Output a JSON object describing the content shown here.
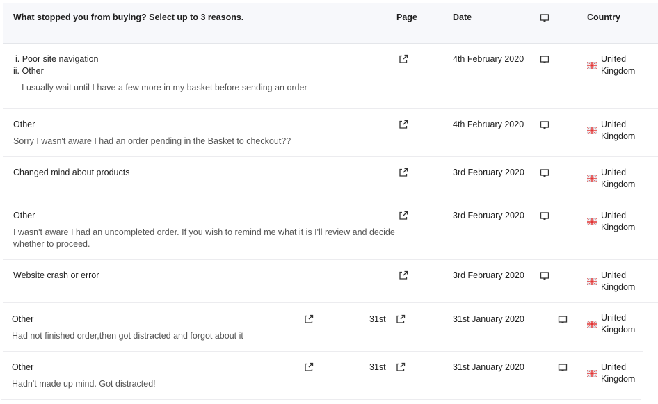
{
  "header": {
    "question": "What stopped you from buying? Select up to 3 reasons.",
    "page": "Page",
    "date": "Date",
    "device_icon": "desktop-icon",
    "country": "Country"
  },
  "rows": [
    {
      "reasons": [
        "i. Poor site navigation",
        "ii. Other"
      ],
      "comment": "I usually wait until I have a few more in my basket before sending an order",
      "page_icon": "external-link-icon",
      "date": "4th February 2020",
      "device_icon": "desktop-icon",
      "flag": "uk-flag-icon",
      "country_line1": "United",
      "country_line2": "Kingdom"
    },
    {
      "reasons": [
        "Other"
      ],
      "comment": "Sorry I wasn't aware I had an order pending in the Basket to checkout??",
      "page_icon": "external-link-icon",
      "date": "4th February 2020",
      "device_icon": "desktop-icon",
      "flag": "uk-flag-icon",
      "country_line1": "United",
      "country_line2": "Kingdom"
    },
    {
      "reasons": [
        "Changed mind about products"
      ],
      "comment": "",
      "page_icon": "external-link-icon",
      "date": "3rd February 2020",
      "device_icon": "desktop-icon",
      "flag": "uk-flag-icon",
      "country_line1": "United",
      "country_line2": "Kingdom"
    },
    {
      "reasons": [
        "Other"
      ],
      "comment_line1": "I wasn't aware I had an uncompleted order. If you wish to remind me what it is I'll review and decide",
      "comment_line2": "whether to proceed.",
      "page_icon": "external-link-icon",
      "date": "3rd February 2020",
      "device_icon": "desktop-icon",
      "flag": "uk-flag-icon",
      "country_line1": "United",
      "country_line2": "Kingdom"
    },
    {
      "reasons": [
        "Website crash or error"
      ],
      "comment": "",
      "page_icon": "external-link-icon",
      "date": "3rd February 2020",
      "device_icon": "desktop-icon",
      "flag": "uk-flag-icon",
      "country_line1": "United",
      "country_line2": "Kingdom"
    },
    {
      "reasons": [
        "Other"
      ],
      "comment": "Had not finished order,then got distracted and forgot about it",
      "extra_label": "31st",
      "page_icon": "external-link-icon",
      "date": "31st January 2020",
      "device_icon": "desktop-icon",
      "flag": "uk-flag-icon",
      "country_line1": "United",
      "country_line2": "Kingdom"
    },
    {
      "reasons": [
        "Other"
      ],
      "comment": "Hadn't made up mind. Got distracted!",
      "extra_label": "31st",
      "page_icon": "external-link-icon",
      "date": "31st January 2020",
      "device_icon": "desktop-icon",
      "flag": "uk-flag-icon",
      "country_line1": "United",
      "country_line2": "Kingdom"
    }
  ]
}
